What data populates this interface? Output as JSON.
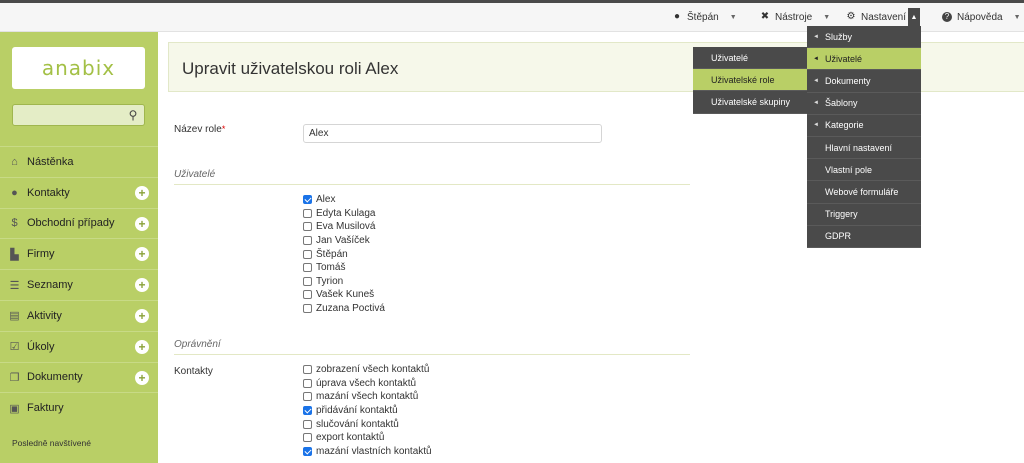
{
  "topbar": {
    "user": {
      "label": "Štěpán",
      "icon": "user-icon"
    },
    "tools": {
      "label": "Nástroje",
      "icon": "tools-icon"
    },
    "settings": {
      "label": "Nastavení",
      "icon": "gear-icon"
    },
    "help": {
      "label": "Nápověda",
      "icon": "help-icon"
    },
    "caret": "▼",
    "caret_up": "▲"
  },
  "sidebar": {
    "logo": "anabix",
    "search_placeholder": "",
    "items": [
      {
        "label": "Nástěnka",
        "icon": "home-icon",
        "glyph": "⌂",
        "plus": false
      },
      {
        "label": "Kontakty",
        "icon": "person-icon",
        "glyph": "●",
        "plus": true
      },
      {
        "label": "Obchodní případy",
        "icon": "dollar-icon",
        "glyph": "$",
        "plus": true
      },
      {
        "label": "Firmy",
        "icon": "firms-icon",
        "glyph": "▙",
        "plus": true
      },
      {
        "label": "Seznamy",
        "icon": "list-icon",
        "glyph": "☰",
        "plus": true
      },
      {
        "label": "Aktivity",
        "icon": "clipboard-icon",
        "glyph": "▤",
        "plus": true
      },
      {
        "label": "Úkoly",
        "icon": "tasks-icon",
        "glyph": "☑",
        "plus": true
      },
      {
        "label": "Dokumenty",
        "icon": "documents-icon",
        "glyph": "❐",
        "plus": true
      },
      {
        "label": "Faktury",
        "icon": "invoice-icon",
        "glyph": "▣",
        "plus": false
      }
    ],
    "plus_glyph": "+",
    "recent_label": "Posledně navštívené"
  },
  "page": {
    "title": "Upravit uživatelskou roli Alex",
    "role_name_label": "Název role",
    "required_mark": "*",
    "role_name_value": "Alex",
    "users_section": "Uživatelé",
    "users": [
      {
        "name": "Alex",
        "checked": true
      },
      {
        "name": "Edyta Kulaga",
        "checked": false
      },
      {
        "name": "Eva Musilová",
        "checked": false
      },
      {
        "name": "Jan Vašíček",
        "checked": false
      },
      {
        "name": "Štěpán",
        "checked": false
      },
      {
        "name": "Tomáš",
        "checked": false
      },
      {
        "name": "Tyrion",
        "checked": false
      },
      {
        "name": "Vašek Kuneš",
        "checked": false
      },
      {
        "name": "Zuzana Poctivá",
        "checked": false
      }
    ],
    "permissions_section": "Oprávnění",
    "contacts_label": "Kontakty",
    "permissions": [
      {
        "name": "zobrazení všech kontaktů",
        "checked": false
      },
      {
        "name": "úprava všech kontaktů",
        "checked": false
      },
      {
        "name": "mazání všech kontaktů",
        "checked": false
      },
      {
        "name": "přidávání kontaktů",
        "checked": true
      },
      {
        "name": "slučování kontaktů",
        "checked": false
      },
      {
        "name": "export kontaktů",
        "checked": false
      },
      {
        "name": "mazání vlastních kontaktů",
        "checked": true
      }
    ]
  },
  "settings_menu": {
    "items": [
      {
        "label": "Služby",
        "arrow": true,
        "selected": false
      },
      {
        "label": "Uživatelé",
        "arrow": true,
        "selected": true
      },
      {
        "label": "Dokumenty",
        "arrow": true,
        "selected": false
      },
      {
        "label": "Šablony",
        "arrow": true,
        "selected": false
      },
      {
        "label": "Kategorie",
        "arrow": true,
        "selected": false
      },
      {
        "label": "Hlavní nastavení",
        "arrow": false,
        "selected": false
      },
      {
        "label": "Vlastní pole",
        "arrow": false,
        "selected": false
      },
      {
        "label": "Webové formuláře",
        "arrow": false,
        "selected": false
      },
      {
        "label": "Triggery",
        "arrow": false,
        "selected": false
      },
      {
        "label": "GDPR",
        "arrow": false,
        "selected": false
      }
    ],
    "arrow_glyph": "◄"
  },
  "users_submenu": {
    "items": [
      {
        "label": "Uživatelé",
        "selected": false
      },
      {
        "label": "Uživatelské role",
        "selected": true
      },
      {
        "label": "Uživatelské skupiny",
        "selected": false
      }
    ]
  },
  "colors": {
    "sidebar": "#b9cf66",
    "menu_bg": "#4a4a4a",
    "menu_selected": "#b9cf66",
    "checkbox_checked": "#1a73e8",
    "required": "#dd0000"
  }
}
